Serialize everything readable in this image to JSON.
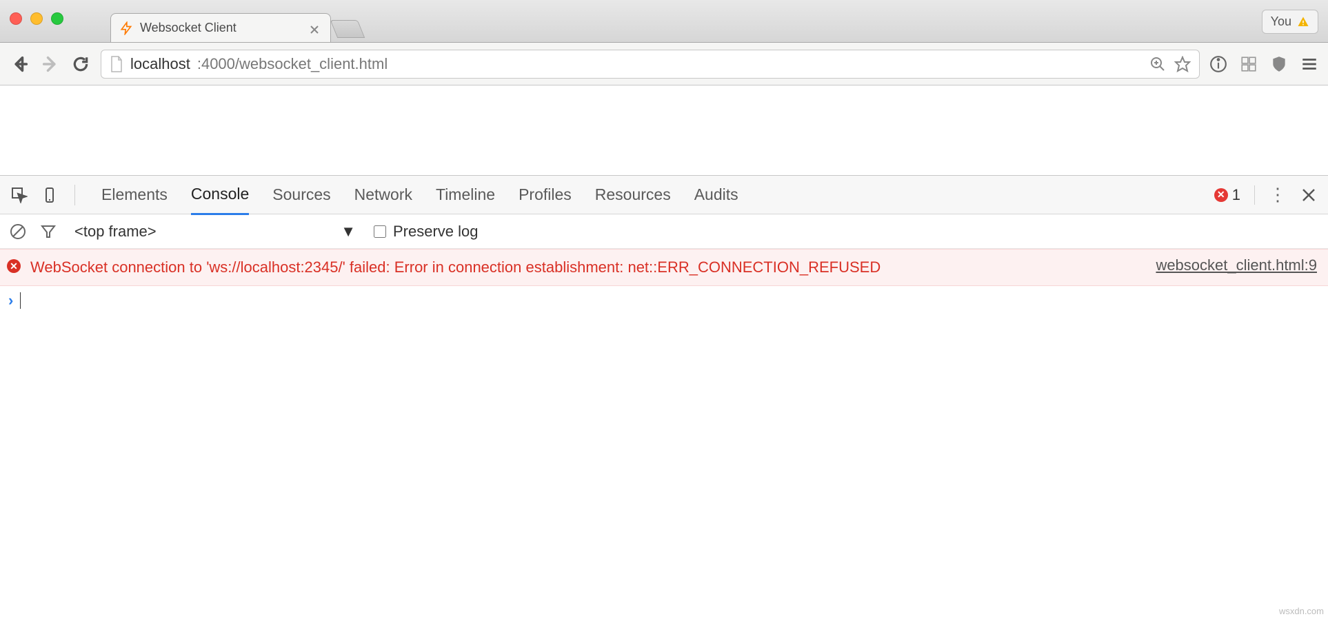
{
  "window": {
    "tab_title": "Websocket Client",
    "you_label": "You"
  },
  "omnibox": {
    "host": "localhost",
    "port_path": ":4000/websocket_client.html"
  },
  "devtools": {
    "tabs": [
      "Elements",
      "Console",
      "Sources",
      "Network",
      "Timeline",
      "Profiles",
      "Resources",
      "Audits"
    ],
    "active_tab": "Console",
    "error_count": "1"
  },
  "console_toolbar": {
    "frame_selector": "<top frame>",
    "preserve_log_label": "Preserve log",
    "preserve_log_checked": false
  },
  "console_messages": [
    {
      "level": "error",
      "text": "WebSocket connection to 'ws://localhost:2345/' failed: Error in connection establishment: net::ERR_CONNECTION_REFUSED",
      "source": "websocket_client.html:9"
    }
  ],
  "watermark": "wsxdn.com"
}
